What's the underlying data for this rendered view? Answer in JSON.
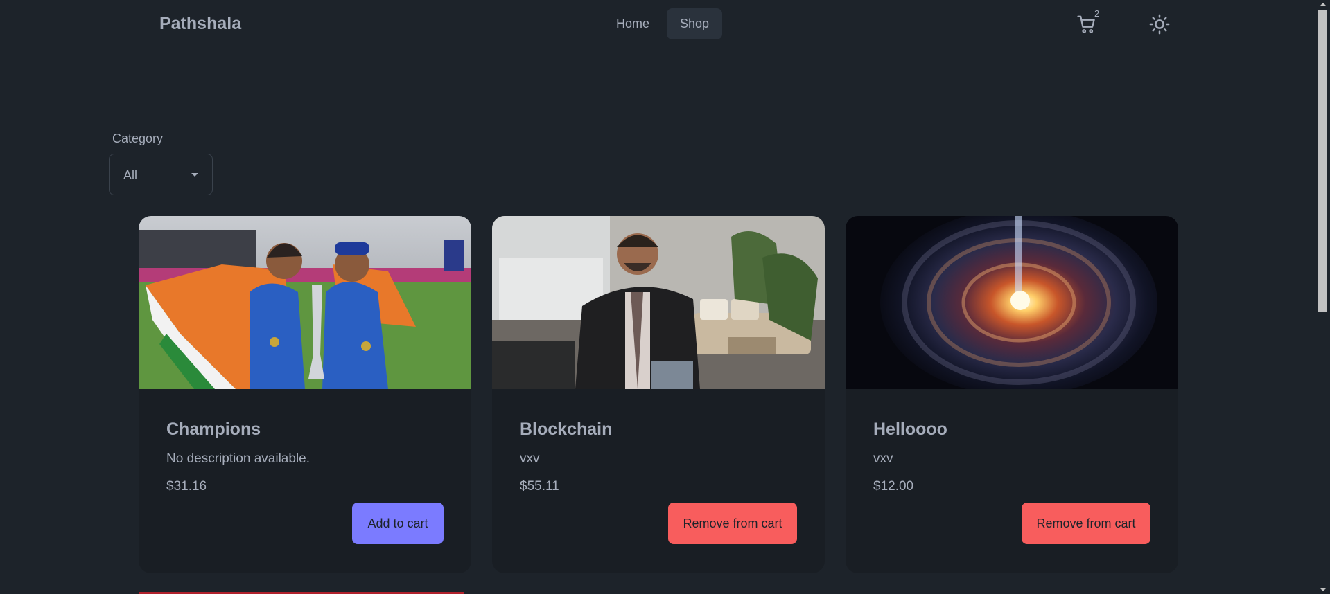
{
  "navbar": {
    "brand": "Pathshala",
    "links": [
      {
        "label": "Home",
        "active": false
      },
      {
        "label": "Shop",
        "active": true
      }
    ],
    "cart_count": "2",
    "cart_icon": "cart-icon",
    "theme_icon": "sun-icon"
  },
  "filter": {
    "label": "Category",
    "selected": "All"
  },
  "products": [
    {
      "title": "Champions",
      "description": "No description available.",
      "price": "$31.16",
      "button": "Add to cart",
      "image": "cricket-champions-photo"
    },
    {
      "title": "Blockchain",
      "description": "vxv",
      "price": "$55.11",
      "button": "Remove from cart",
      "image": "man-in-blazer-photo"
    },
    {
      "title": "Helloooo",
      "description": "vxv",
      "price": "$12.00",
      "button": "Remove from cart",
      "image": "cosmic-vortex-image"
    }
  ],
  "colors": {
    "background": "#1d232a",
    "card": "#191e24",
    "primary": "#7b7bff",
    "error": "#f85d5d",
    "text": "#a6adbb"
  }
}
